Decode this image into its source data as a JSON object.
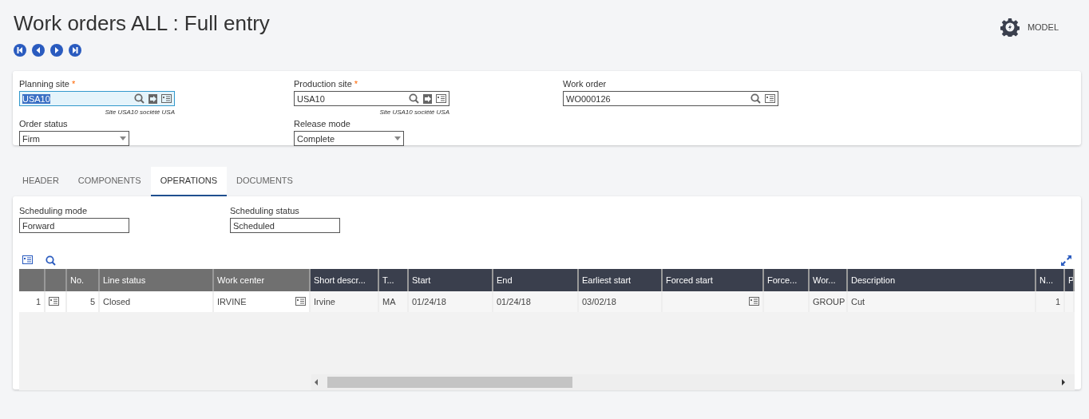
{
  "title": "Work orders ALL : Full entry",
  "model_button": "MODEL",
  "fields": [
    {
      "label": "Planning site",
      "required_mark": "*",
      "value": "USA10",
      "focused": true,
      "hint": "Site USA10 société USA",
      "kind": "lookup"
    },
    {
      "label": "Production site",
      "required_mark": "*",
      "value": "USA10",
      "focused": false,
      "hint": "Site USA10 société USA",
      "kind": "lookup"
    },
    {
      "label": "Work order",
      "value": "WO000126",
      "focused": false,
      "kind": "lookup-short"
    },
    {
      "label": "Order status",
      "value": "Firm",
      "kind": "select"
    },
    {
      "label": "Release mode",
      "value": "Complete",
      "kind": "select"
    }
  ],
  "tabs": [
    {
      "label": "HEADER",
      "selected": false
    },
    {
      "label": "COMPONENTS",
      "selected": false
    },
    {
      "label": "OPERATIONS",
      "selected": true
    },
    {
      "label": "DOCUMENTS",
      "selected": false
    }
  ],
  "scheduling": [
    {
      "label": "Scheduling mode",
      "value": "Forward"
    },
    {
      "label": "Scheduling status",
      "value": "Scheduled"
    }
  ],
  "table": {
    "columns": [
      {
        "frozen": true
      },
      {
        "frozen": true
      },
      {
        "label": "No.",
        "frozen": true
      },
      {
        "label": "Line status",
        "frozen": true
      },
      {
        "label": "Work center",
        "frozen": true
      },
      {
        "label": "Short descr...",
        "frozen": false
      },
      {
        "label": "T...",
        "frozen": false
      },
      {
        "label": "Start",
        "frozen": false
      },
      {
        "label": "End",
        "frozen": false
      },
      {
        "label": "Earliest start",
        "frozen": false
      },
      {
        "label": "Forced start",
        "frozen": false
      },
      {
        "label": "Force...",
        "frozen": false
      },
      {
        "label": "Wor...",
        "frozen": false
      },
      {
        "label": "Description",
        "frozen": false
      },
      {
        "label": "N...",
        "frozen": false
      },
      {
        "label": "P",
        "frozen": false
      }
    ],
    "rows": [
      [
        "1",
        "",
        "5",
        "Closed",
        "IRVINE",
        "Irvine",
        "MA",
        "01/24/18",
        "01/24/18",
        "03/02/18",
        "",
        "",
        "GROUP",
        "Cut",
        "1",
        ""
      ]
    ]
  }
}
